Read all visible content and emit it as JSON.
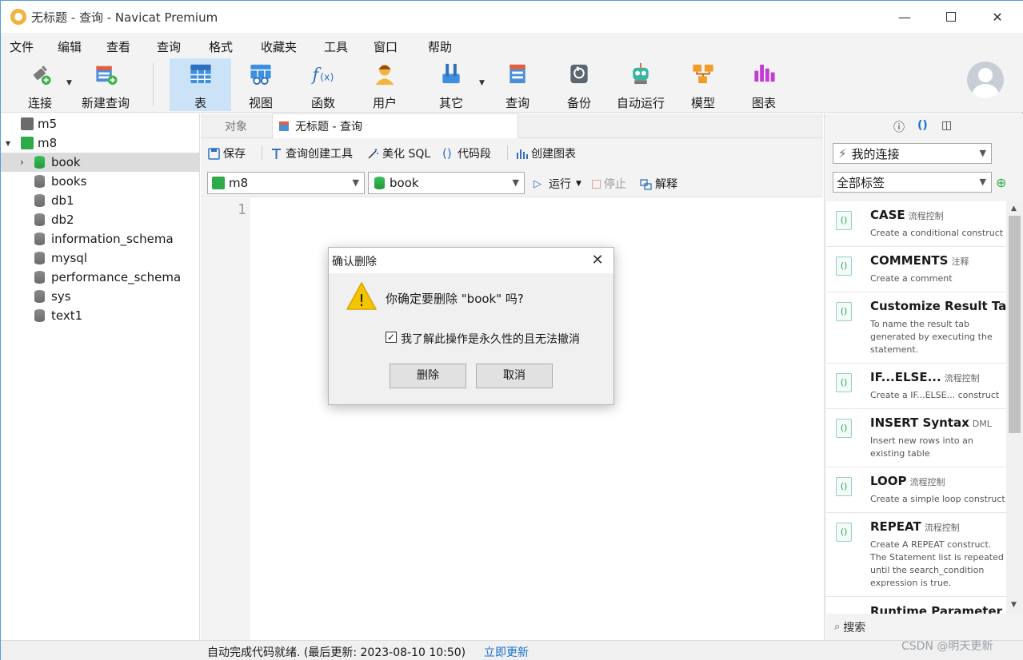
{
  "window": {
    "title": "无标题 - 查询 - Navicat Premium",
    "minimize_glyph": "—",
    "close_glyph": "✕"
  },
  "menubar": [
    "文件",
    "编辑",
    "查看",
    "查询",
    "格式",
    "收藏夹",
    "工具",
    "窗口",
    "帮助"
  ],
  "toolbar": {
    "connect": "连接",
    "new_query": "新建查询",
    "table": "表",
    "view": "视图",
    "function": "函数",
    "user": "用户",
    "other": "其它",
    "query": "查询",
    "backup": "备份",
    "automation": "自动运行",
    "model": "模型",
    "chart": "图表"
  },
  "tree": {
    "connections": [
      {
        "name": "m5",
        "expanded": false
      },
      {
        "name": "m8",
        "expanded": true
      }
    ],
    "databases": [
      "book",
      "books",
      "db1",
      "db2",
      "information_schema",
      "mysql",
      "performance_schema",
      "sys",
      "text1"
    ],
    "selected": "book"
  },
  "tabs": {
    "objects": "对象",
    "query_tab": "无标题 - 查询"
  },
  "editor_toolbar": {
    "save": "保存",
    "query_builder": "查询创建工具",
    "beautify": "美化 SQL",
    "snippet": "代码段",
    "create_chart": "创建图表"
  },
  "selectors": {
    "connection": "m8",
    "database": "book",
    "run": "运行",
    "stop": "停止",
    "explain": "解释"
  },
  "editor": {
    "line_number": "1"
  },
  "right_pane": {
    "connection_combo": "我的连接",
    "tags_combo": "全部标签",
    "search_placeholder": "搜索",
    "snippets": [
      {
        "name": "CASE",
        "category": "流程控制",
        "desc": "Create a conditional construct"
      },
      {
        "name": "COMMENTS",
        "category": "注释",
        "desc": "Create a comment"
      },
      {
        "name": "Customize Result Tab N",
        "category": "",
        "desc": "To name the result tab generated by executing the statement."
      },
      {
        "name": "IF...ELSE...",
        "category": "流程控制",
        "desc": "Create a IF...ELSE... construct"
      },
      {
        "name": "INSERT Syntax",
        "category": "DML",
        "desc": "Insert new rows into an existing table"
      },
      {
        "name": "LOOP",
        "category": "流程控制",
        "desc": "Create a simple loop construct"
      },
      {
        "name": "REPEAT",
        "category": "流程控制",
        "desc": "Create A REPEAT construct. The Statement list is repeated until the search_condition expression is true."
      },
      {
        "name": "Runtime Parameter",
        "category": "",
        "desc": ""
      }
    ]
  },
  "status": {
    "text": "自动完成代码就绪. (最后更新: 2023-08-10 10:50)",
    "link": "立即更新"
  },
  "watermark": "CSDN @明天更新",
  "dialog": {
    "title": "确认删除",
    "message": "你确定要删除 \"book\" 吗?",
    "checkbox_label": "我了解此操作是永久性的且无法撤消",
    "checkbox_checked": true,
    "checkbox_glyph": "✓",
    "delete_button": "删除",
    "cancel_button": "取消",
    "warning_glyph": "!"
  },
  "colors": {
    "accent": "#1a6fd0",
    "toolbar_active": "#cce3f7",
    "selected_row": "#dcdcdc",
    "warning": "#f5c400"
  }
}
